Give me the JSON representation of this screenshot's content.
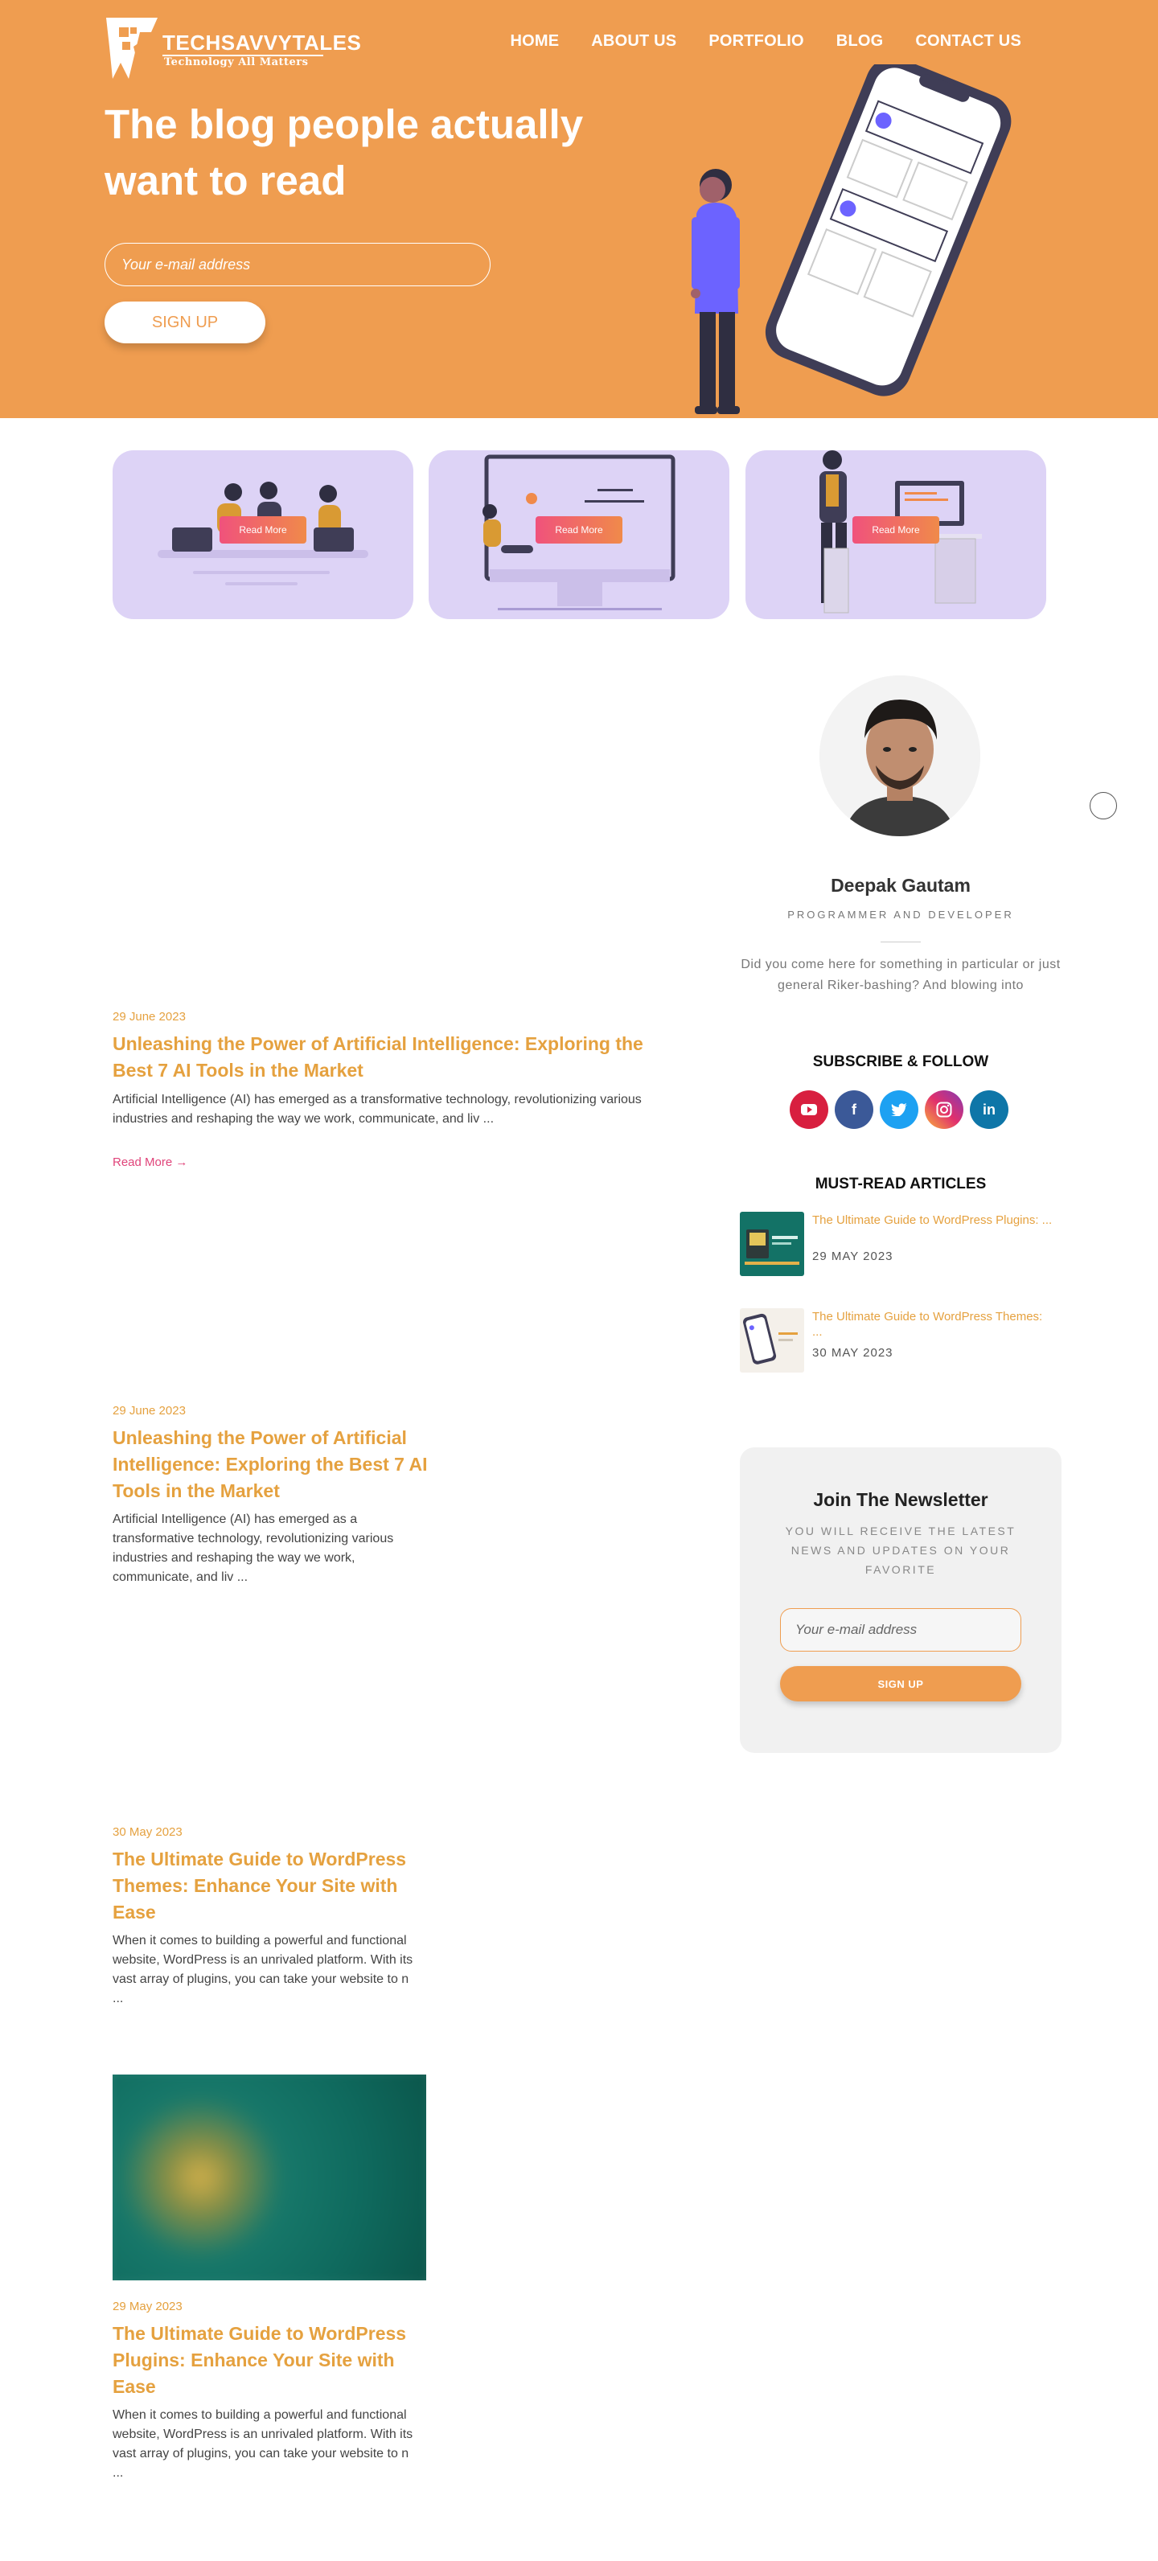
{
  "site": {
    "logo_name": "TECHSAVVYTALES",
    "logo_tagline": "Technology All Matters"
  },
  "nav": {
    "items": [
      "HOME",
      "ABOUT US",
      "PORTFOLIO",
      "BLOG",
      "CONTACT US"
    ]
  },
  "hero": {
    "title": "The blog people actually want to read",
    "email_placeholder": "Your e-mail address",
    "signup_label": "SIGN UP"
  },
  "feature_cards": [
    {
      "button_label": "Read More"
    },
    {
      "button_label": "Read More"
    },
    {
      "button_label": "Read More"
    }
  ],
  "posts": [
    {
      "date": "29 June 2023",
      "title": "Unleashing the Power of Artificial Intelligence: Exploring the Best 7 AI Tools in the Market",
      "excerpt": "Artificial Intelligence (AI) has emerged as a transformative technology, revolutionizing various industries and reshaping the way we work, communicate, and liv ...",
      "read_more": "Read More →"
    },
    {
      "date": "29 June 2023",
      "title": "Unleashing the Power of Artificial Intelligence: Exploring the Best 7 AI Tools in the Market",
      "excerpt": "Artificial Intelligence (AI) has emerged as a transformative technology, revolutionizing various industries and reshaping the way we work, communicate, and liv ..."
    },
    {
      "date": "30 May 2023",
      "title": "The Ultimate Guide to WordPress Themes: Enhance Your Site with Ease",
      "excerpt": "When it comes to building a powerful and functional website, WordPress is an unrivaled platform. With its vast array of plugins, you can take your website to n ..."
    },
    {
      "date": "29 May 2023",
      "title": "The Ultimate Guide to WordPress Plugins: Enhance Your Site with Ease",
      "excerpt": "When it comes to building a powerful and functional website, WordPress is an unrivaled platform. With its vast array of plugins, you can take your website to n ..."
    }
  ],
  "sidebar": {
    "author_name": "Deepak Gautam",
    "author_role": "PROGRAMMER AND DEVELOPER",
    "author_bio": "Did you come here for something in particular or just general Riker-bashing? And blowing into",
    "subscribe_heading": "SUBSCRIBE & FOLLOW",
    "socials": [
      {
        "icon": "youtube-icon",
        "color": "#d81f3f"
      },
      {
        "icon": "facebook-icon",
        "color": "#3b5998"
      },
      {
        "icon": "twitter-icon",
        "color": "#1da1f2"
      },
      {
        "icon": "instagram-icon",
        "color": "#e1306c"
      },
      {
        "icon": "linkedin-icon",
        "color": "#0e76a8"
      }
    ],
    "must_read_heading": "MUST-READ ARTICLES",
    "must_read": [
      {
        "title": "The Ultimate Guide to WordPress Plugins: ...",
        "date": "29 MAY 2023"
      },
      {
        "title": "The Ultimate Guide to WordPress Themes: ...",
        "date": "30 MAY 2023"
      }
    ]
  },
  "newsletter": {
    "title": "Join The Newsletter",
    "subtitle": "YOU WILL RECEIVE THE LATEST NEWS AND UPDATES ON YOUR FAVORITE",
    "email_placeholder": "Your e-mail address",
    "button_label": "SIGN UP"
  },
  "colors": {
    "brand_orange": "#ef9d50",
    "title_gold": "#e5a13f",
    "card_lavender": "#ddd3f6",
    "read_more_pink": "#e0447a"
  }
}
